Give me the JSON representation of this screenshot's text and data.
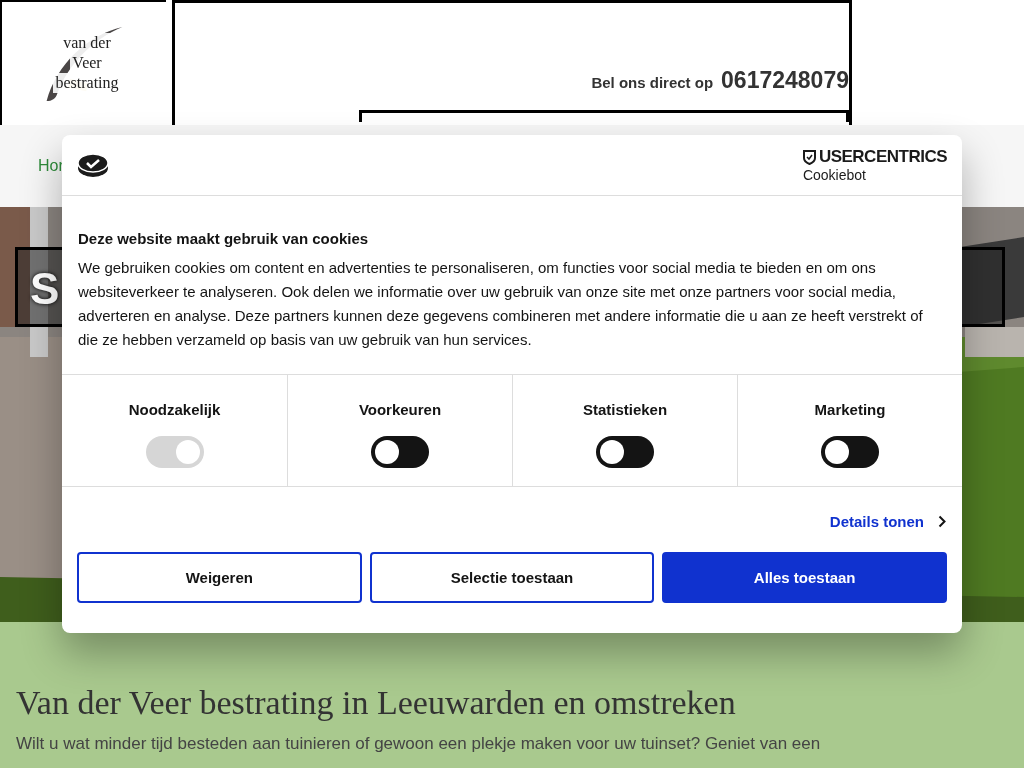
{
  "header": {
    "logo_lines": [
      "van der",
      "Veer",
      "bestrating"
    ],
    "phone_label": "Bel ons direct op",
    "phone": "0617248079"
  },
  "nav": {
    "items": [
      {
        "label": "Hor",
        "selected": true
      }
    ]
  },
  "hero": {
    "kind": "picture",
    "title": "S"
  },
  "intro": {
    "title": "Van der Veer bestrating in Leeuwarden en omstreken",
    "text": "Wilt u wat minder tijd besteden aan tuinieren of gewoon een plekje maken voor uw tuinset? Geniet van een"
  },
  "cookie_dialog": {
    "brand": "USERCENTRICS",
    "brand_sub": "Cookiebot",
    "title": "Deze website maakt gebruik van cookies",
    "text": "We gebruiken cookies om content en advertenties te personaliseren, om functies voor social media te bieden en om ons websiteverkeer te analyseren. Ook delen we informatie over uw gebruik van onze site met onze partners voor social media, adverteren en analyse. Deze partners kunnen deze gegevens combineren met andere informatie die u aan ze heeft verstrekt of die ze hebben verzameld op basis van uw gebruik van hun services.",
    "categories": [
      {
        "label": "Noodzakelijk",
        "checked": true,
        "disabled": true
      },
      {
        "label": "Voorkeuren",
        "checked": false,
        "disabled": false
      },
      {
        "label": "Statistieken",
        "checked": false,
        "disabled": false
      },
      {
        "label": "Marketing",
        "checked": false,
        "disabled": false
      }
    ],
    "details_link": "Details tonen",
    "buttons": [
      {
        "label": "Weigeren",
        "kind": "outline"
      },
      {
        "label": "Selectie toestaan",
        "kind": "outline"
      },
      {
        "label": "Alles toestaan",
        "kind": "primary"
      }
    ]
  }
}
